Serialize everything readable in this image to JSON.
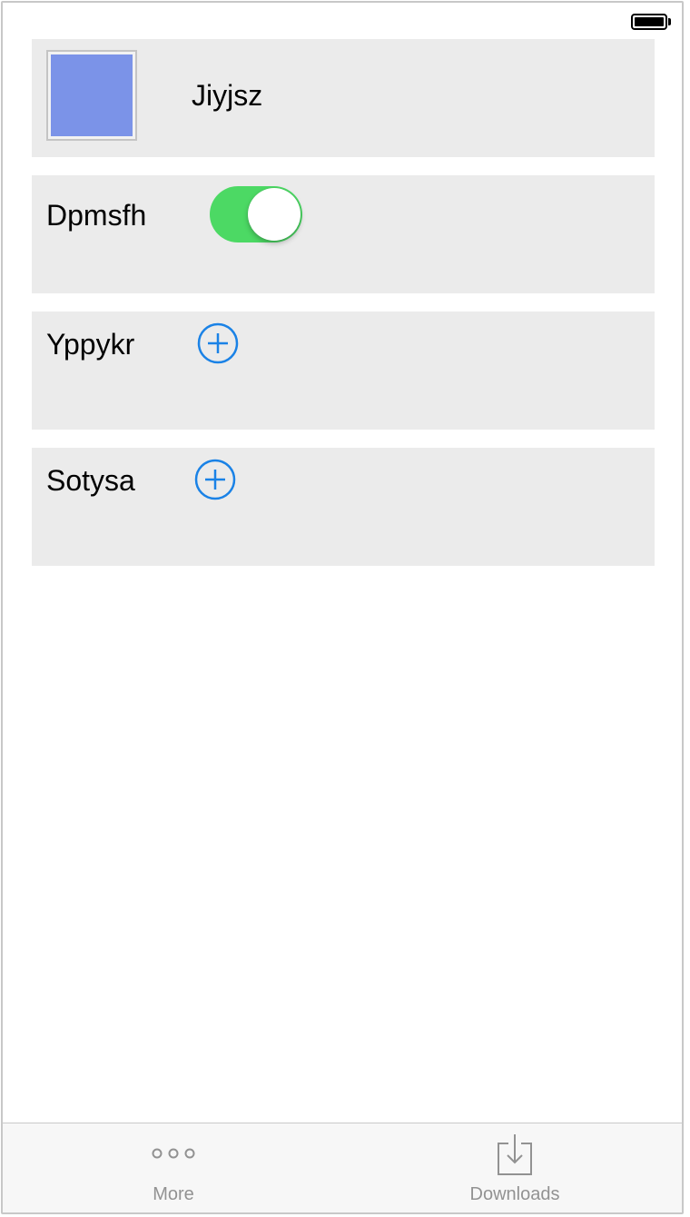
{
  "status_bar": {
    "battery_icon": "battery-full-icon"
  },
  "rows": [
    {
      "type": "image",
      "label": "Jiyjsz",
      "swatch_color": "#7b93e8"
    },
    {
      "type": "toggle",
      "label": "Dpmsfh",
      "toggle_on": true,
      "toggle_color": "#4cd964"
    },
    {
      "type": "add",
      "label": "Yppykr",
      "icon": "plus-circle-icon",
      "accent": "#1a82e6"
    },
    {
      "type": "add",
      "label": "Sotysa",
      "icon": "plus-circle-icon",
      "accent": "#1a82e6"
    }
  ],
  "tab_bar": {
    "tabs": [
      {
        "label": "More",
        "icon": "more-dots-icon"
      },
      {
        "label": "Downloads",
        "icon": "download-tray-icon"
      }
    ]
  }
}
